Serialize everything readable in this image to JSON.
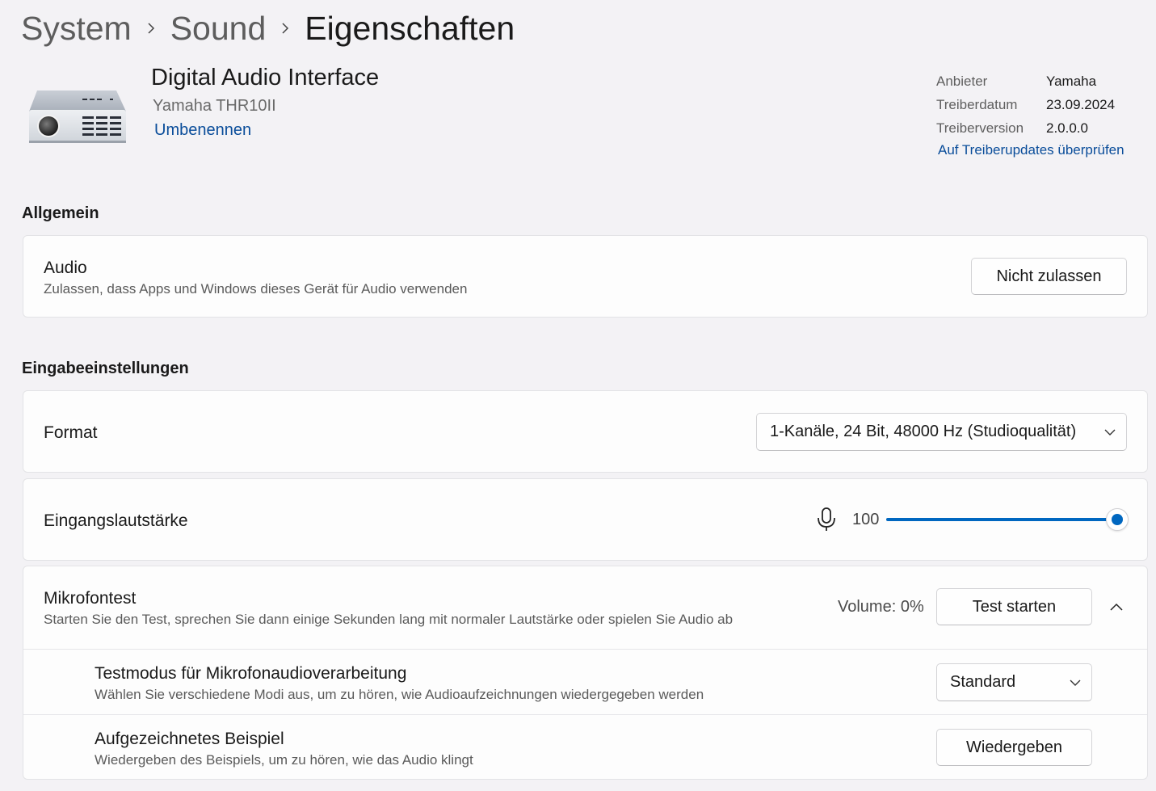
{
  "breadcrumb": {
    "items": [
      "System",
      "Sound",
      "Eigenschaften"
    ]
  },
  "device": {
    "name": "Digital Audio Interface",
    "model": "Yamaha THR10II",
    "rename_label": "Umbenennen",
    "icon": "audio-device-icon"
  },
  "driver_info": {
    "rows": [
      {
        "key": "Anbieter",
        "value": "Yamaha"
      },
      {
        "key": "Treiberdatum",
        "value": "23.09.2024"
      },
      {
        "key": "Treiberversion",
        "value": "2.0.0.0"
      }
    ],
    "update_link": "Auf Treiberupdates überprüfen"
  },
  "general": {
    "section_title": "Allgemein",
    "audio": {
      "title": "Audio",
      "description": "Zulassen, dass Apps und Windows dieses Gerät für Audio verwenden",
      "button_label": "Nicht zulassen"
    }
  },
  "input_settings": {
    "section_title": "Eingabeeinstellungen",
    "format": {
      "title": "Format",
      "selected": "1-Kanäle, 24 Bit, 48000 Hz (Studioqualität)"
    },
    "volume": {
      "title": "Eingangslautstärke",
      "value_label": "100",
      "value": 100,
      "icon": "microphone-icon"
    },
    "mic_test": {
      "title": "Mikrofontest",
      "description": "Starten Sie den Test, sprechen Sie dann einige Sekunden lang mit normaler Lautstärke oder spielen Sie Audio ab",
      "volume_label": "Volume: 0%",
      "button_label": "Test starten",
      "expanded": true,
      "test_mode": {
        "title": "Testmodus für Mikrofonaudioverarbeitung",
        "description": "Wählen Sie verschiedene Modi aus, um zu hören, wie Audioaufzeichnungen wiedergegeben werden",
        "selected": "Standard"
      },
      "recorded_sample": {
        "title": "Aufgezeichnetes Beispiel",
        "description": "Wiedergeben des Beispiels, um zu hören, wie das Audio klingt",
        "button_label": "Wiedergeben"
      }
    }
  },
  "colors": {
    "accent": "#0067c0",
    "link": "#0a4d9a",
    "background": "#f3f2f5",
    "card": "#fdfdfd"
  }
}
